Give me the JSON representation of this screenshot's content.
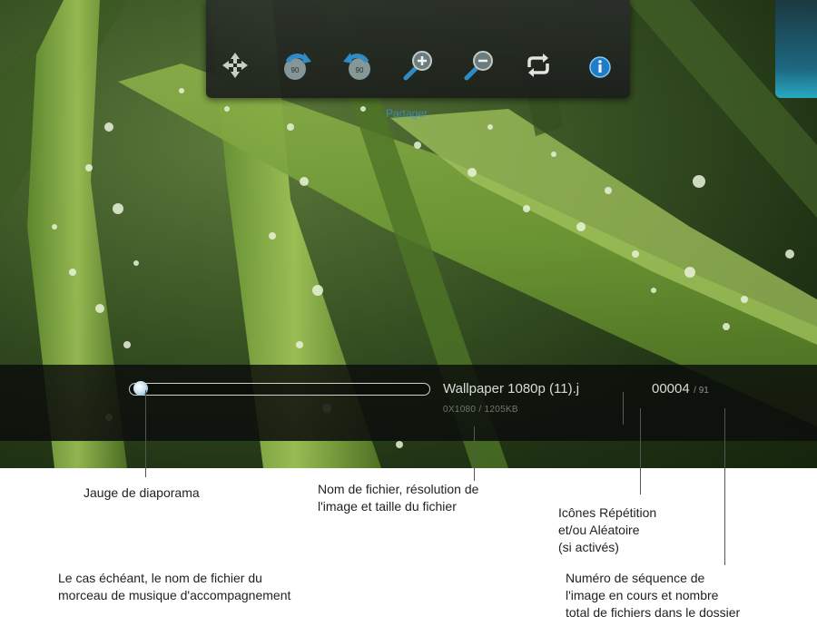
{
  "toolbar": {
    "buttons": [
      {
        "name": "move-pan-button",
        "icon": "move-arrows-icon"
      },
      {
        "name": "rotate-clockwise-button",
        "icon": "rotate-right-90-icon"
      },
      {
        "name": "rotate-counterclockwise-button",
        "icon": "rotate-left-90-icon"
      },
      {
        "name": "zoom-in-button",
        "icon": "zoom-in-icon"
      },
      {
        "name": "zoom-out-button",
        "icon": "zoom-out-icon"
      },
      {
        "name": "repeat-button",
        "icon": "repeat-icon"
      },
      {
        "name": "info-button",
        "icon": "info-icon"
      }
    ],
    "ghost_label": "Partager"
  },
  "infobar": {
    "slideshow_progress": 0.02,
    "filename": "Wallpaper 1080p (11).j",
    "resolution_size": "0X1080 / 1205KB",
    "sequence_current": "00004",
    "sequence_total": "/ 91"
  },
  "annotations": {
    "gauge": "Jauge de diaporama",
    "music_line1": "Le cas échéant, le nom de fichier du",
    "music_line2": "morceau de musique d'accompagnement",
    "filename_line1": "Nom de fichier, résolution de",
    "filename_line2": "l'image et taille du fichier",
    "repeat_line1": "Icônes Répétition",
    "repeat_line2": "et/ou Aléatoire",
    "repeat_line3": "(si activés)",
    "sequence_line1": "Numéro de séquence de",
    "sequence_line2": "l'image en cours et nombre",
    "sequence_line3": "total de fichiers dans le dossier"
  },
  "colors": {
    "accent": "#2ab1cf",
    "toolbar_bg": "#1b1f1b"
  }
}
